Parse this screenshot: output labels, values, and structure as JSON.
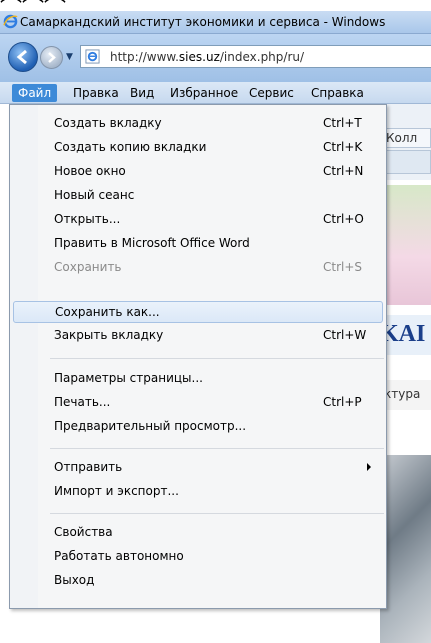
{
  "window": {
    "title": "Самаркандский институт экономики и сервиса - Windows"
  },
  "address_bar": {
    "url_prefix": "http://www.",
    "url_domain": "sies.uz",
    "url_suffix": "/index.php/ru/"
  },
  "menubar": {
    "items": [
      "Файл",
      "Правка",
      "Вид",
      "Избранное",
      "Сервис",
      "Справка"
    ],
    "active": "Файл"
  },
  "background": {
    "tab_fragment": "Колл",
    "banner_fragment": "KAI",
    "nav_fragment": "ктура"
  },
  "file_menu": {
    "items": [
      {
        "label": "Создать вкладку",
        "shortcut": "Ctrl+T"
      },
      {
        "label": "Создать копию вкладки",
        "shortcut": "Ctrl+K"
      },
      {
        "label": "Новое окно",
        "shortcut": "Ctrl+N"
      },
      {
        "label": "Новый сеанс",
        "shortcut": ""
      },
      {
        "label": "Открыть...",
        "shortcut": "Ctrl+O"
      },
      {
        "label": "Править в Microsoft Office Word",
        "shortcut": ""
      },
      {
        "label": "Сохранить",
        "shortcut": "Ctrl+S",
        "disabled": true
      },
      {
        "label": "Сохранить как...",
        "shortcut": "",
        "highlighted": true
      },
      {
        "label": "Закрыть вкладку",
        "shortcut": "Ctrl+W"
      },
      {
        "label": "Параметры страницы...",
        "shortcut": ""
      },
      {
        "label": "Печать...",
        "shortcut": "Ctrl+P"
      },
      {
        "label": "Предварительный просмотр...",
        "shortcut": ""
      },
      {
        "label": "Отправить",
        "shortcut": "",
        "submenu": true
      },
      {
        "label": "Импорт и экспорт...",
        "shortcut": ""
      },
      {
        "label": "Свойства",
        "shortcut": ""
      },
      {
        "label": "Работать автономно",
        "shortcut": ""
      },
      {
        "label": "Выход",
        "shortcut": ""
      }
    ]
  },
  "colors": {
    "menu_active_bg": "#3d8ad8",
    "hover_border": "#a7c2e4",
    "disabled_text": "#8a8a8a"
  }
}
